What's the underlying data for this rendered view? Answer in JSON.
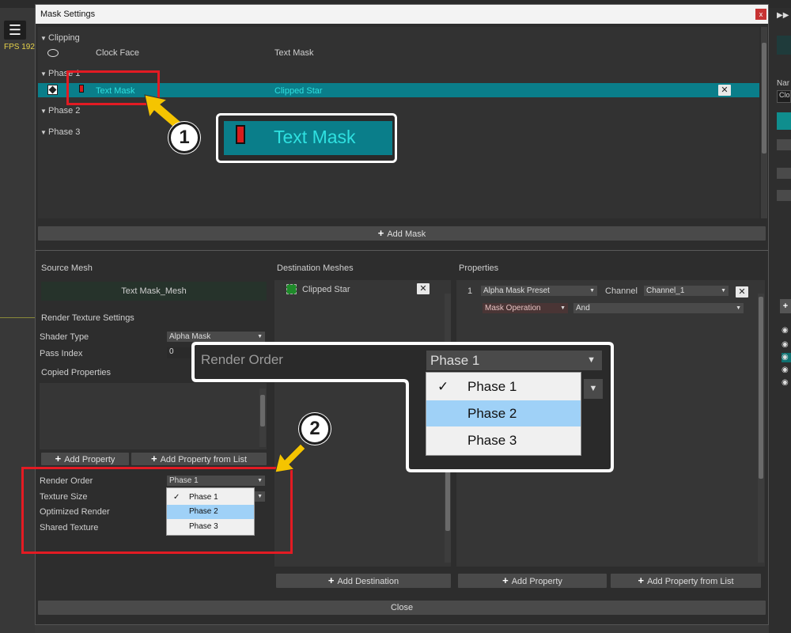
{
  "app": {
    "fps_label": "FPS 192",
    "right_panel": {
      "name_label": "Nar",
      "clock_field": "Clo"
    }
  },
  "window": {
    "title": "Mask Settings",
    "close_glyph": "x"
  },
  "mask_list": {
    "groups": [
      {
        "name": "Clipping"
      },
      {
        "name": "Phase 1"
      },
      {
        "name": "Phase 2"
      },
      {
        "name": "Phase 3"
      }
    ],
    "clipping_row": {
      "source": "Clock Face",
      "dest": "Text Mask"
    },
    "phase1_row": {
      "source": "Text Mask",
      "dest": "Clipped Star"
    },
    "add_mask_label": "Add Mask"
  },
  "zoom_callout_1": {
    "label": "Text Mask",
    "number": "1"
  },
  "source_mesh": {
    "header": "Source Mesh",
    "mesh_name": "Text Mask_Mesh",
    "rt_settings": "Render Texture Settings",
    "shader_type_label": "Shader Type",
    "shader_type_value": "Alpha Mask",
    "pass_index_label": "Pass Index",
    "pass_index_value": "0",
    "copied_props_label": "Copied Properties",
    "add_property": "Add Property",
    "add_property_list": "Add Property from List",
    "render_order_label": "Render Order",
    "render_order_value": "Phase 1",
    "texture_size_label": "Texture Size",
    "optimized_render_label": "Optimized Render",
    "shared_texture_label": "Shared Texture",
    "dropdown_options": [
      "Phase 1",
      "Phase 2",
      "Phase 3"
    ],
    "checked_option": "Phase 1",
    "highlighted_option": "Phase 2"
  },
  "zoom_callout_2": {
    "label": "Render Order",
    "value": "Phase 1",
    "options": [
      "Phase 1",
      "Phase 2",
      "Phase 3"
    ],
    "number": "2"
  },
  "destination": {
    "header": "Destination Meshes",
    "items": [
      {
        "name": "Clipped Star"
      }
    ],
    "add_destination": "Add Destination"
  },
  "properties": {
    "header": "Properties",
    "row_index": "1",
    "preset_value": "Alpha Mask Preset",
    "channel_label": "Channel",
    "channel_value": "Channel_1",
    "mask_op_value": "Mask Operation",
    "and_value": "And",
    "add_property": "Add Property",
    "add_property_list": "Add Property from List"
  },
  "footer": {
    "close_label": "Close"
  },
  "colors": {
    "accent_teal": "#0a7e8a",
    "highlight_red": "#e31b23",
    "arrow_yellow": "#f5c400",
    "selection_blue": "#9fd1f7"
  }
}
